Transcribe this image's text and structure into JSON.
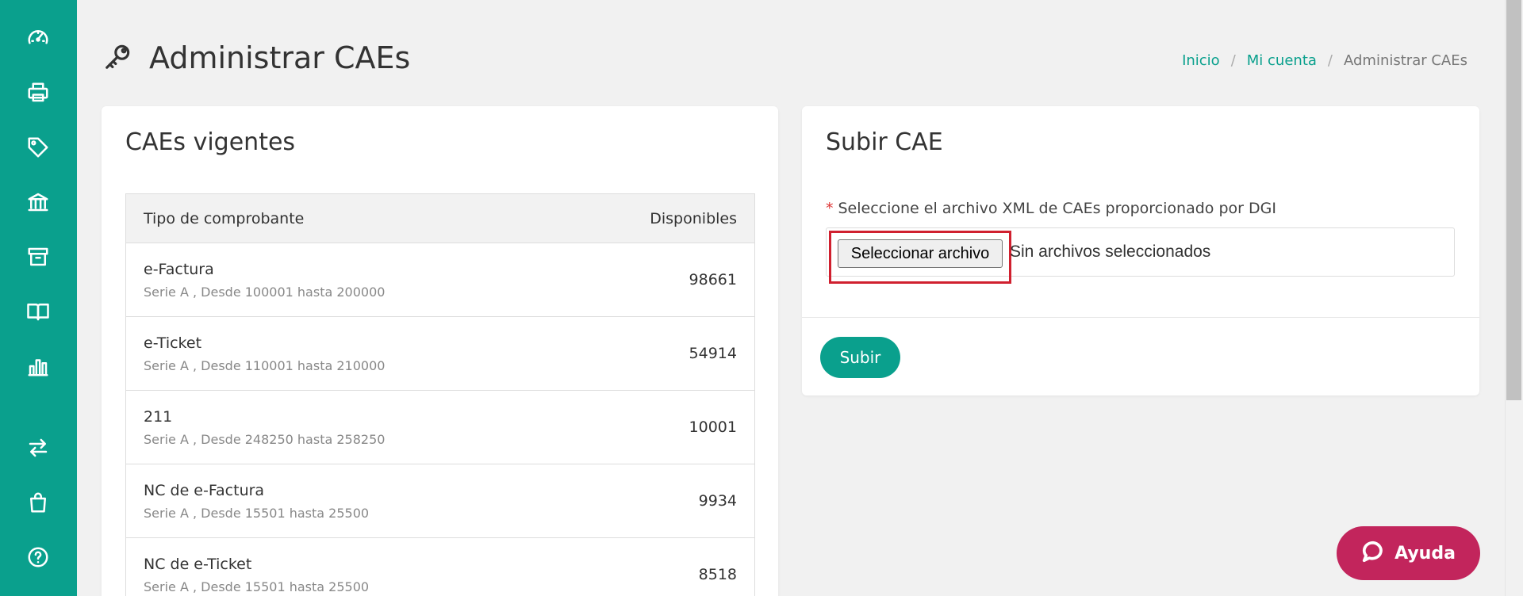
{
  "sidebar": {
    "items": [
      {
        "icon": "speedometer-icon"
      },
      {
        "icon": "printer-icon"
      },
      {
        "icon": "tag-icon"
      },
      {
        "icon": "bank-icon"
      },
      {
        "icon": "archive-box-icon"
      },
      {
        "icon": "book-icon"
      },
      {
        "icon": "bar-chart-icon"
      },
      {
        "icon": "transfer-arrows-icon"
      },
      {
        "icon": "shopping-bag-icon"
      },
      {
        "icon": "help-circle-icon"
      }
    ]
  },
  "header": {
    "icon": "key-icon",
    "title": "Administrar CAEs"
  },
  "breadcrumb": {
    "home": "Inicio",
    "account": "Mi cuenta",
    "current": "Administrar CAEs",
    "separator": "/"
  },
  "caes": {
    "title": "CAEs vigentes",
    "columns": {
      "type": "Tipo de comprobante",
      "available": "Disponibles"
    },
    "rows": [
      {
        "name": "e-Factura",
        "detail": "Serie A , Desde 100001 hasta 200000",
        "available": "98661"
      },
      {
        "name": "e-Ticket",
        "detail": "Serie A , Desde 110001 hasta 210000",
        "available": "54914"
      },
      {
        "name": "211",
        "detail": "Serie A , Desde 248250 hasta 258250",
        "available": "10001"
      },
      {
        "name": "NC de e-Factura",
        "detail": "Serie A , Desde 15501 hasta 25500",
        "available": "9934"
      },
      {
        "name": "NC de e-Ticket",
        "detail": "Serie A , Desde 15501 hasta 25500",
        "available": "8518"
      }
    ]
  },
  "upload": {
    "title": "Subir CAE",
    "required_mark": "*",
    "label": "Seleccione el archivo XML de CAEs proporcionado por DGI",
    "file_button": "Seleccionar archivo",
    "file_status": "Sin archivos seleccionados",
    "submit": "Subir"
  },
  "help": {
    "label": "Ayuda",
    "icon": "chat-bubble-icon"
  },
  "colors": {
    "primary": "#0aa08d",
    "help": "#c2255c",
    "highlight": "#d0202f"
  }
}
